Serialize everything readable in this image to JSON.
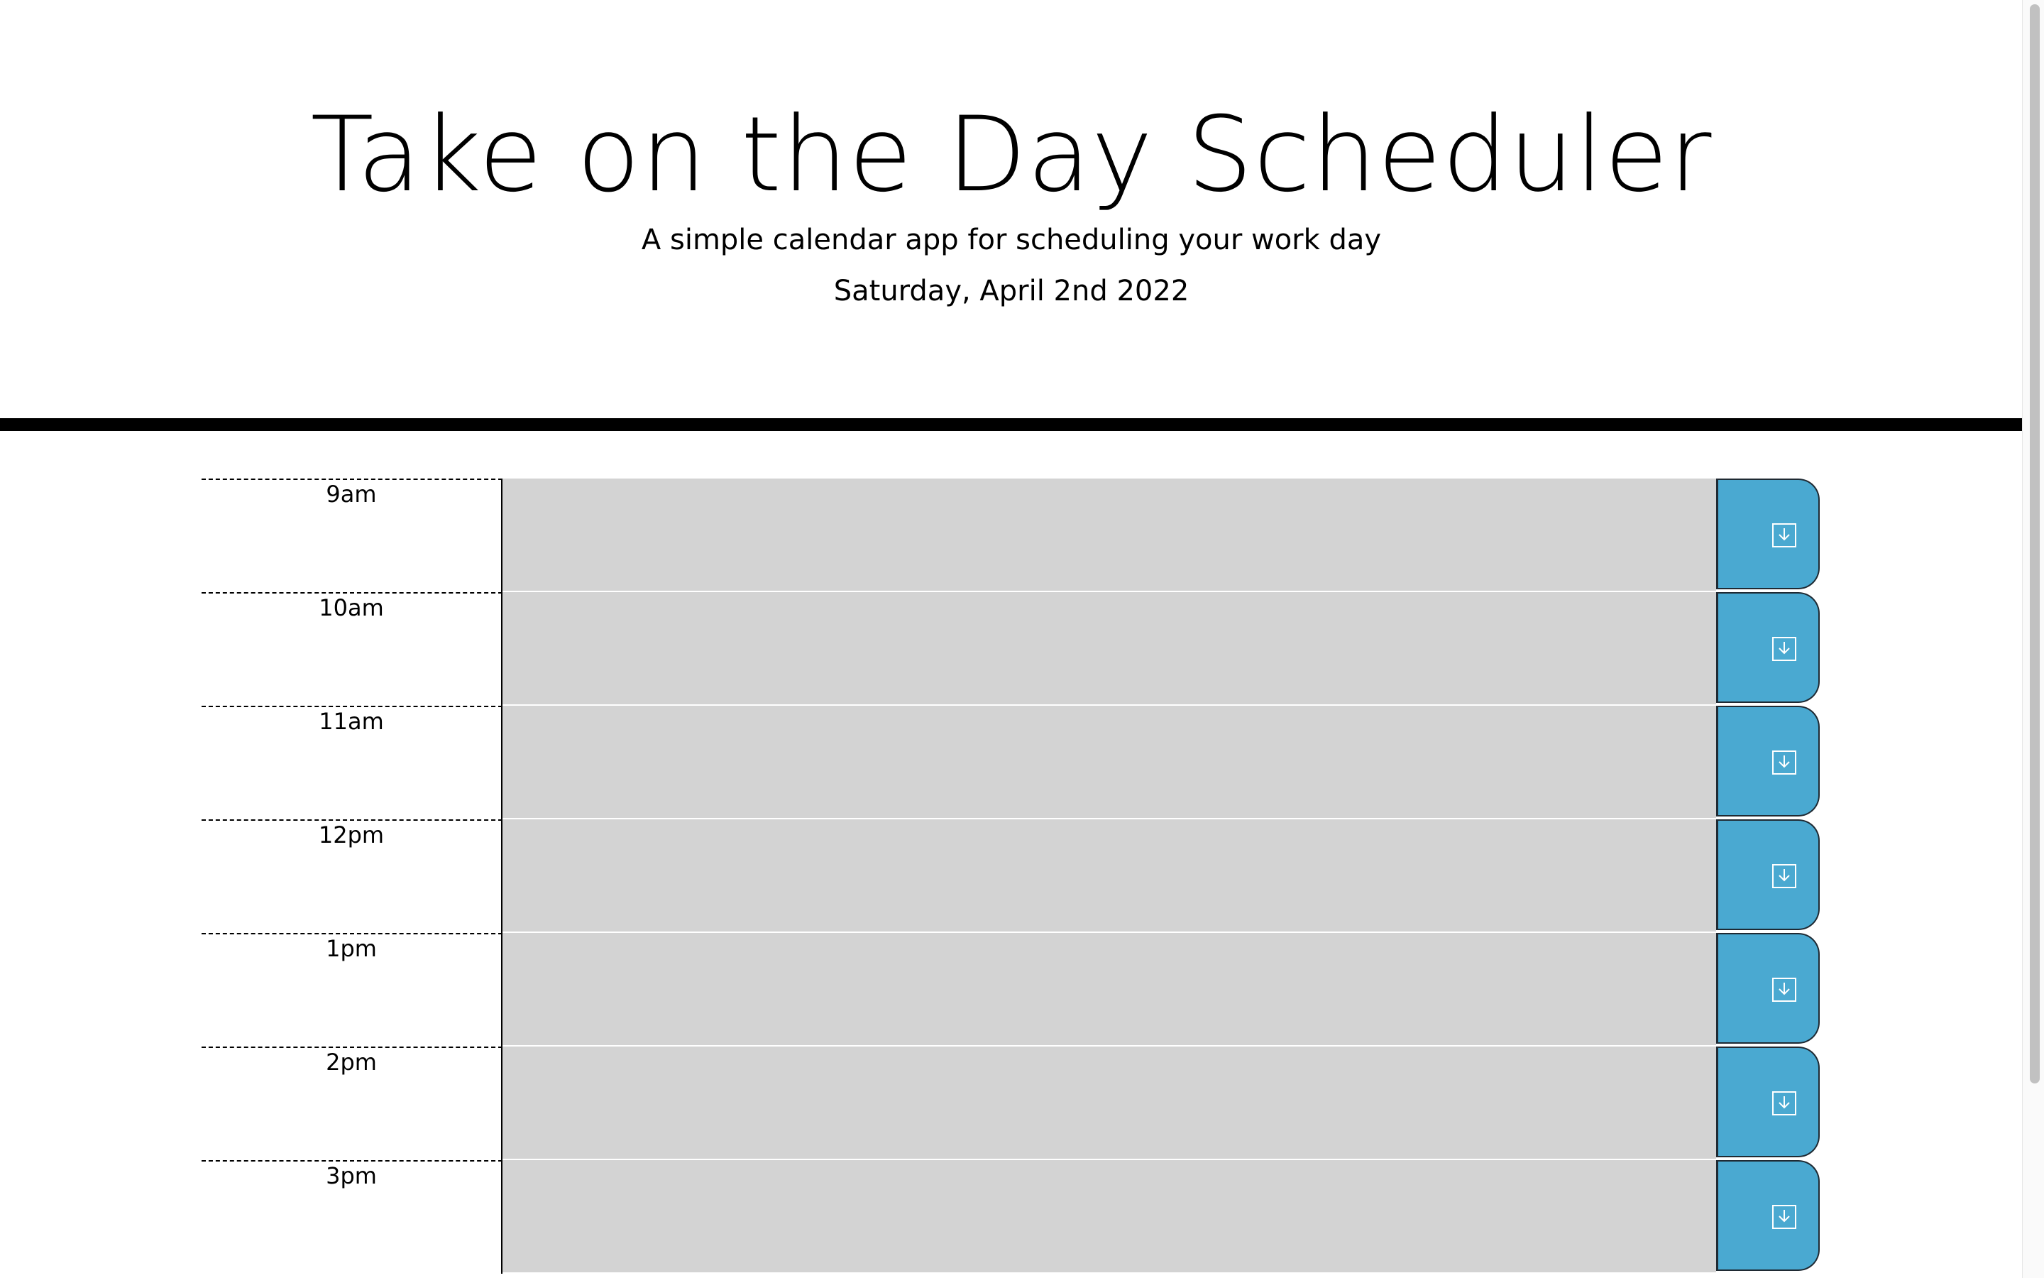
{
  "header": {
    "title": "Take on the Day Scheduler",
    "lead": "A simple calendar app for scheduling your work day",
    "current_day": "Saturday, April 2nd 2022"
  },
  "schedule": {
    "blocks": [
      {
        "hour": "9am",
        "description": ""
      },
      {
        "hour": "10am",
        "description": ""
      },
      {
        "hour": "11am",
        "description": ""
      },
      {
        "hour": "12pm",
        "description": ""
      },
      {
        "hour": "1pm",
        "description": ""
      },
      {
        "hour": "2pm",
        "description": ""
      },
      {
        "hour": "3pm",
        "description": ""
      }
    ],
    "save_icon": "save-download-icon"
  },
  "colors": {
    "past_block": "#d3d3d3",
    "save_button": "#4aa9d1",
    "divider": "#000000"
  }
}
